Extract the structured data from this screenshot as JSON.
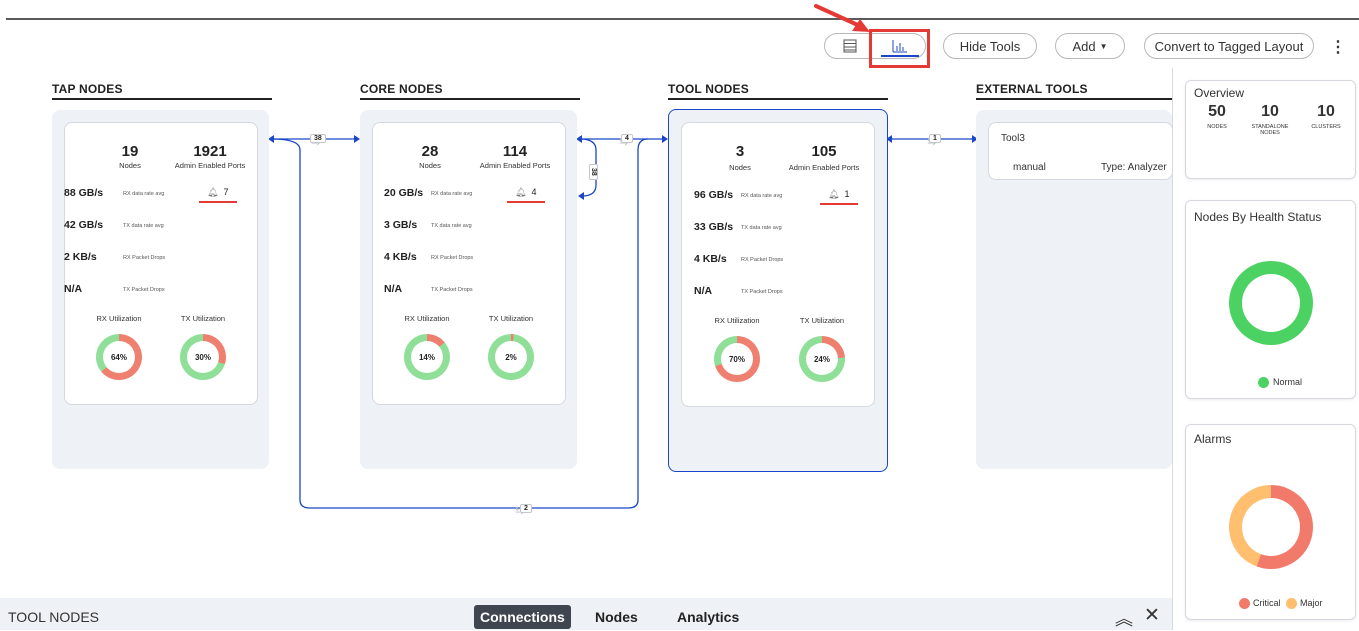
{
  "toolbar": {
    "hide_tools": "Hide Tools",
    "add": "Add",
    "convert": "Convert to Tagged Layout",
    "table_view_icon": "table-icon",
    "chart_view_icon": "bar-chart-icon"
  },
  "columns": [
    {
      "title": "TAP NODES"
    },
    {
      "title": "CORE NODES"
    },
    {
      "title": "TOOL NODES"
    },
    {
      "title": "EXTERNAL TOOLS"
    }
  ],
  "common_labels": {
    "nodes": "Nodes",
    "admin_ports": "Admin Enabled Ports",
    "rx_rate": "RX data rate avg",
    "tx_rate": "TX data rate avg",
    "rx_drops": "RX Packet Drops",
    "tx_drops": "TX Packet Drops",
    "rx_util": "RX Utilization",
    "tx_util": "TX Utilization"
  },
  "tap": {
    "nodes": "19",
    "ports": "1921",
    "rx_rate": "88 GB/s",
    "tx_rate": "42 GB/s",
    "rx_drops": "2 KB/s",
    "tx_drops": "N/A",
    "alarms": "7",
    "rx_util": "64%",
    "tx_util": "30%",
    "rx_pct": 64,
    "tx_pct": 30
  },
  "core": {
    "nodes": "28",
    "ports": "114",
    "rx_rate": "20 GB/s",
    "tx_rate": "3 GB/s",
    "rx_drops": "4 KB/s",
    "tx_drops": "N/A",
    "alarms": "4",
    "rx_util": "14%",
    "tx_util": "2%",
    "rx_pct": 14,
    "tx_pct": 2
  },
  "tool": {
    "nodes": "3",
    "ports": "105",
    "rx_rate": "96 GB/s",
    "tx_rate": "33 GB/s",
    "rx_drops": "4 KB/s",
    "tx_drops": "N/A",
    "alarms": "1",
    "rx_util": "70%",
    "tx_util": "24%",
    "rx_pct": 70,
    "tx_pct": 24
  },
  "external": {
    "name": "Tool3",
    "mode": "manual",
    "type": "Type: Analyzer"
  },
  "edges": {
    "tap_core": "38",
    "core_tool": "4",
    "core_self": "38",
    "tool_ext": "1",
    "tap_tool": "2"
  },
  "overview": {
    "title": "Overview",
    "nodes": "50",
    "nodes_label": "NODES",
    "standalone": "10",
    "standalone_label": "STANDALONE NODES",
    "clusters": "10",
    "clusters_label": "CLUSTERS"
  },
  "health": {
    "title": "Nodes By Health Status",
    "legend_normal": "Normal"
  },
  "alarms_panel": {
    "title": "Alarms",
    "legend_critical": "Critical",
    "legend_major": "Major"
  },
  "bottom": {
    "title": "TOOL NODES",
    "tabs": [
      "Connections",
      "Nodes",
      "Analytics"
    ]
  },
  "colors": {
    "accent_blue": "#1a47c8",
    "util_red": "#ef8070",
    "util_green": "#8fdf98",
    "health_green": "#4cd262",
    "critical": "#f17a6b",
    "major": "#ffbf6e"
  }
}
